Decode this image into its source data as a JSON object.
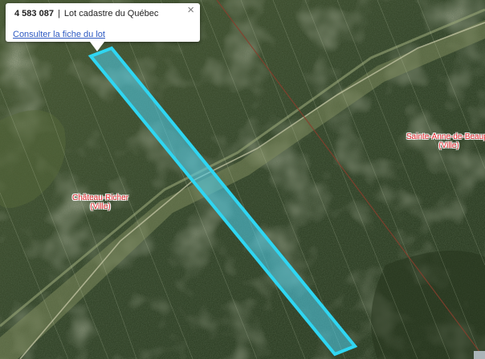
{
  "popup": {
    "lot_number": "4 583 087",
    "separator": "|",
    "lot_type": "Lot cadastre du Québec",
    "link_label": "Consulter la fiche du lot",
    "close_label": "×"
  },
  "places": [
    {
      "name": "Château-Richer",
      "type": "(Ville)"
    },
    {
      "name": "Sainte-Anne-de-Beaupré",
      "type": "(Ville)"
    }
  ],
  "colors": {
    "lot_fill": "#4fd2ee",
    "lot_stroke": "#2fd6f2",
    "place_label": "#e3282e",
    "link": "#2d59c2",
    "boundary_line": "#8a3d2c"
  },
  "icons": {
    "close": "close-icon"
  }
}
